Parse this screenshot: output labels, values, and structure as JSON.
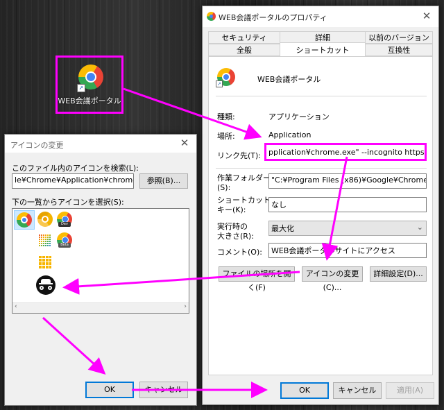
{
  "desktop": {
    "shortcut_label": "WEB会議ポータル"
  },
  "properties_dialog": {
    "title": "WEB会議ポータルのプロパティ",
    "tabs_row1": [
      "セキュリティ",
      "詳細",
      "以前のバージョン"
    ],
    "tabs_row2": [
      "全般",
      "ショートカット",
      "互換性"
    ],
    "active_tab": "ショートカット",
    "shortcut_name": "WEB会議ポータル",
    "fields": {
      "type_label": "種類:",
      "type_value": "アプリケーション",
      "location_label": "場所:",
      "location_value": "Application",
      "target_label": "リンク先(T):",
      "target_value": "pplication¥chrome.exe\" --incognito https://sites",
      "start_in_label_1": "作業フォルダー",
      "start_in_label_2": "(S):",
      "start_in_value": "\"C:¥Program Files (x86)¥Google¥Chrome¥Applic",
      "hotkey_label_1": "ショートカット",
      "hotkey_label_2": "キー(K):",
      "hotkey_value": "なし",
      "run_label_1": "実行時の",
      "run_label_2": "大きさ(R):",
      "run_value": "最大化",
      "comment_label": "コメント(O):",
      "comment_value": "WEB会議ポータルサイトにアクセス"
    },
    "buttons": {
      "open_location": "ファイルの場所を開く(F)",
      "change_icon": "アイコンの変更(C)...",
      "advanced": "詳細設定(D)...",
      "ok": "OK",
      "cancel": "キャンセル",
      "apply": "適用(A)"
    }
  },
  "change_icon_dialog": {
    "title": "アイコンの変更",
    "search_label": "このファイル内のアイコンを検索(L):",
    "path_value": "le¥Chrome¥Application¥chrome.exe",
    "browse_button": "参照(B)...",
    "list_label": "下の一覧からアイコンを選択(S):",
    "icons": [
      "chrome-icon",
      "chrome-canary-icon",
      "chrome-dev-icon",
      "apps-grid-icon",
      "chrome-beta-icon",
      "apps-grid-yellow-icon",
      "incognito-icon"
    ],
    "badge_dev": "Dev",
    "badge_beta": "Beta",
    "ok": "OK",
    "cancel": "キャンセル"
  },
  "colors": {
    "annotation": "#ff00ff",
    "focus_blue": "#0078d7"
  }
}
